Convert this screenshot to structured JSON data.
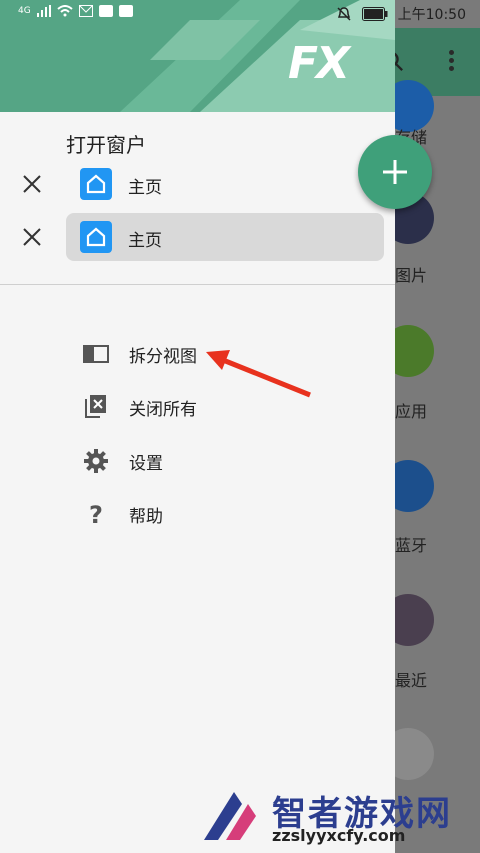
{
  "status_bar": {
    "network": "4G",
    "time": "上午10:50"
  },
  "drawer": {
    "logo_text": "FX",
    "open_windows_title": "打开窗户",
    "windows": [
      {
        "label": "主页",
        "active": false
      },
      {
        "label": "主页",
        "active": true
      }
    ],
    "menu": [
      {
        "label": "拆分视图",
        "icon": "split-view-icon"
      },
      {
        "label": "关闭所有",
        "icon": "close-all-icon"
      },
      {
        "label": "设置",
        "icon": "gear-icon"
      },
      {
        "label": "帮助",
        "icon": "help-icon"
      }
    ]
  },
  "background": {
    "items": [
      {
        "label": "存储"
      },
      {
        "label": "图片"
      },
      {
        "label": "应用"
      },
      {
        "label": "蓝牙"
      },
      {
        "label": "最近"
      },
      {
        "label": ""
      }
    ]
  },
  "watermark": {
    "text": "智者游戏网",
    "url": "zzslyyxcfy.com"
  },
  "colors": {
    "accent": "#55a585",
    "fab": "#3fa07a",
    "home_icon": "#2196f3",
    "arrow": "#e8321e"
  }
}
